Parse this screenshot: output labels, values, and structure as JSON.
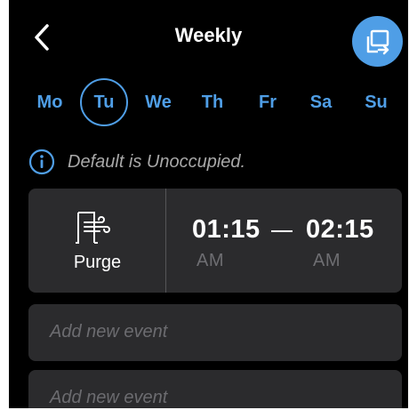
{
  "header": {
    "title": "Weekly",
    "back_icon": "chevron-left-icon",
    "copy_icon": "copy-schedule-icon",
    "accent_color": "#4f9ee6"
  },
  "days": [
    {
      "label": "Mo",
      "selected": false
    },
    {
      "label": "Tu",
      "selected": true
    },
    {
      "label": "We",
      "selected": false
    },
    {
      "label": "Th",
      "selected": false
    },
    {
      "label": "Fr",
      "selected": false
    },
    {
      "label": "Sa",
      "selected": false
    },
    {
      "label": "Su",
      "selected": false
    }
  ],
  "info": {
    "icon": "info-icon",
    "text": "Default is Unoccupied."
  },
  "event": {
    "mode_icon": "purge-icon",
    "mode_label": "Purge",
    "start_time": "01:15",
    "start_ampm": "AM",
    "end_time": "02:15",
    "end_ampm": "AM"
  },
  "add_events": [
    {
      "placeholder": "Add new event"
    },
    {
      "placeholder": "Add new event"
    }
  ],
  "colors": {
    "background": "#000000",
    "card": "#2b2b2d",
    "muted_text": "#6c6c70"
  }
}
